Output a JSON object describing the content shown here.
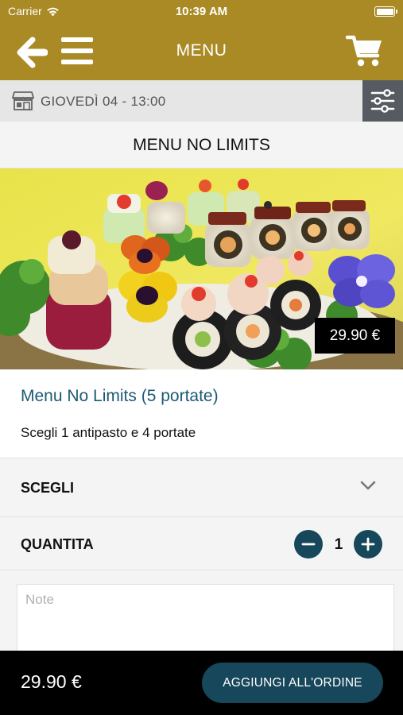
{
  "status_bar": {
    "carrier": "Carrier",
    "time": "10:39 AM",
    "battery_level": 1.0
  },
  "nav": {
    "title": "MENU",
    "icons": [
      "back-arrow-icon",
      "hamburger-menu-icon",
      "cart-icon"
    ]
  },
  "date_bar": {
    "date_text": "GIOVEDÌ 04 - 13:00",
    "icons": [
      "storefront-icon",
      "filter-sliders-icon"
    ]
  },
  "page_title": "MENU NO LIMITS",
  "product": {
    "price_badge": "29.90 €",
    "name": "Menu No Limits (5 portate)",
    "description": "Scegli 1 antipasto e 4 portate",
    "image_icon": "sushi-platter-photo"
  },
  "options": {
    "choose_label": "SCEGLI",
    "quantity_label": "QUANTITA",
    "quantity_value": "1"
  },
  "notes": {
    "placeholder": "Note",
    "value": ""
  },
  "footer": {
    "total": "29.90 €",
    "add_button_label": "AGGIUNGI ALL'ORDINE"
  },
  "colors": {
    "accent_gold": "#a98a25",
    "primary_teal": "#17475a",
    "product_name": "#1c5a73"
  }
}
